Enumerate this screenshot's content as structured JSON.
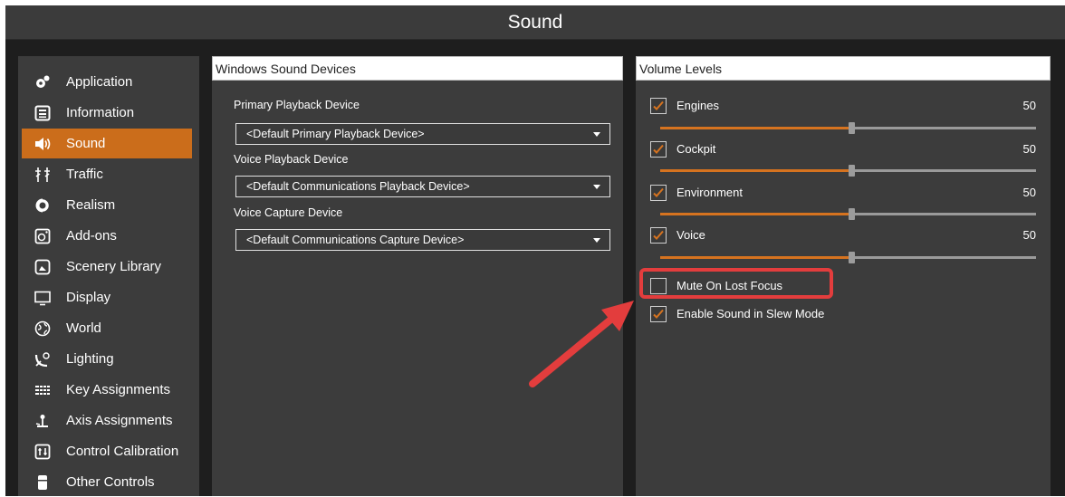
{
  "window": {
    "title": "Sound"
  },
  "sidebar": {
    "items": [
      {
        "label": "Application",
        "icon": "gears-icon"
      },
      {
        "label": "Information",
        "icon": "info-list-icon"
      },
      {
        "label": "Sound",
        "icon": "speaker-icon",
        "active": true
      },
      {
        "label": "Traffic",
        "icon": "traffic-icon"
      },
      {
        "label": "Realism",
        "icon": "realism-icon"
      },
      {
        "label": "Add-ons",
        "icon": "addons-icon"
      },
      {
        "label": "Scenery Library",
        "icon": "scenery-icon"
      },
      {
        "label": "Display",
        "icon": "monitor-icon"
      },
      {
        "label": "World",
        "icon": "globe-icon"
      },
      {
        "label": "Lighting",
        "icon": "lighting-icon"
      },
      {
        "label": "Key Assignments",
        "icon": "keyboard-icon"
      },
      {
        "label": "Axis Assignments",
        "icon": "joystick-icon"
      },
      {
        "label": "Control Calibration",
        "icon": "calibration-icon"
      },
      {
        "label": "Other Controls",
        "icon": "controls-icon"
      }
    ]
  },
  "devices": {
    "header": "Windows Sound Devices",
    "primary_label": "Primary Playback Device",
    "primary_value": "<Default Primary Playback Device>",
    "voice_playback_label": "Voice Playback Device",
    "voice_playback_value": "<Default Communications Playback Device>",
    "voice_capture_label": "Voice Capture Device",
    "voice_capture_value": "<Default Communications Capture Device>"
  },
  "volume": {
    "header": "Volume Levels",
    "channels": [
      {
        "label": "Engines",
        "value": "50",
        "checked": true,
        "level": 0.5
      },
      {
        "label": "Cockpit",
        "value": "50",
        "checked": true,
        "level": 0.5
      },
      {
        "label": "Environment",
        "value": "50",
        "checked": true,
        "level": 0.5
      },
      {
        "label": "Voice",
        "value": "50",
        "checked": true,
        "level": 0.5
      }
    ],
    "mute_on_lost_focus": {
      "label": "Mute On Lost Focus",
      "checked": false
    },
    "slew_mode": {
      "label": "Enable Sound in Slew Mode",
      "checked": true
    }
  },
  "colors": {
    "accent": "#cb6d1b",
    "slider_fill": "#d6731f",
    "annotation": "#e33d3d",
    "panel_bg": "#3c3c3c"
  }
}
